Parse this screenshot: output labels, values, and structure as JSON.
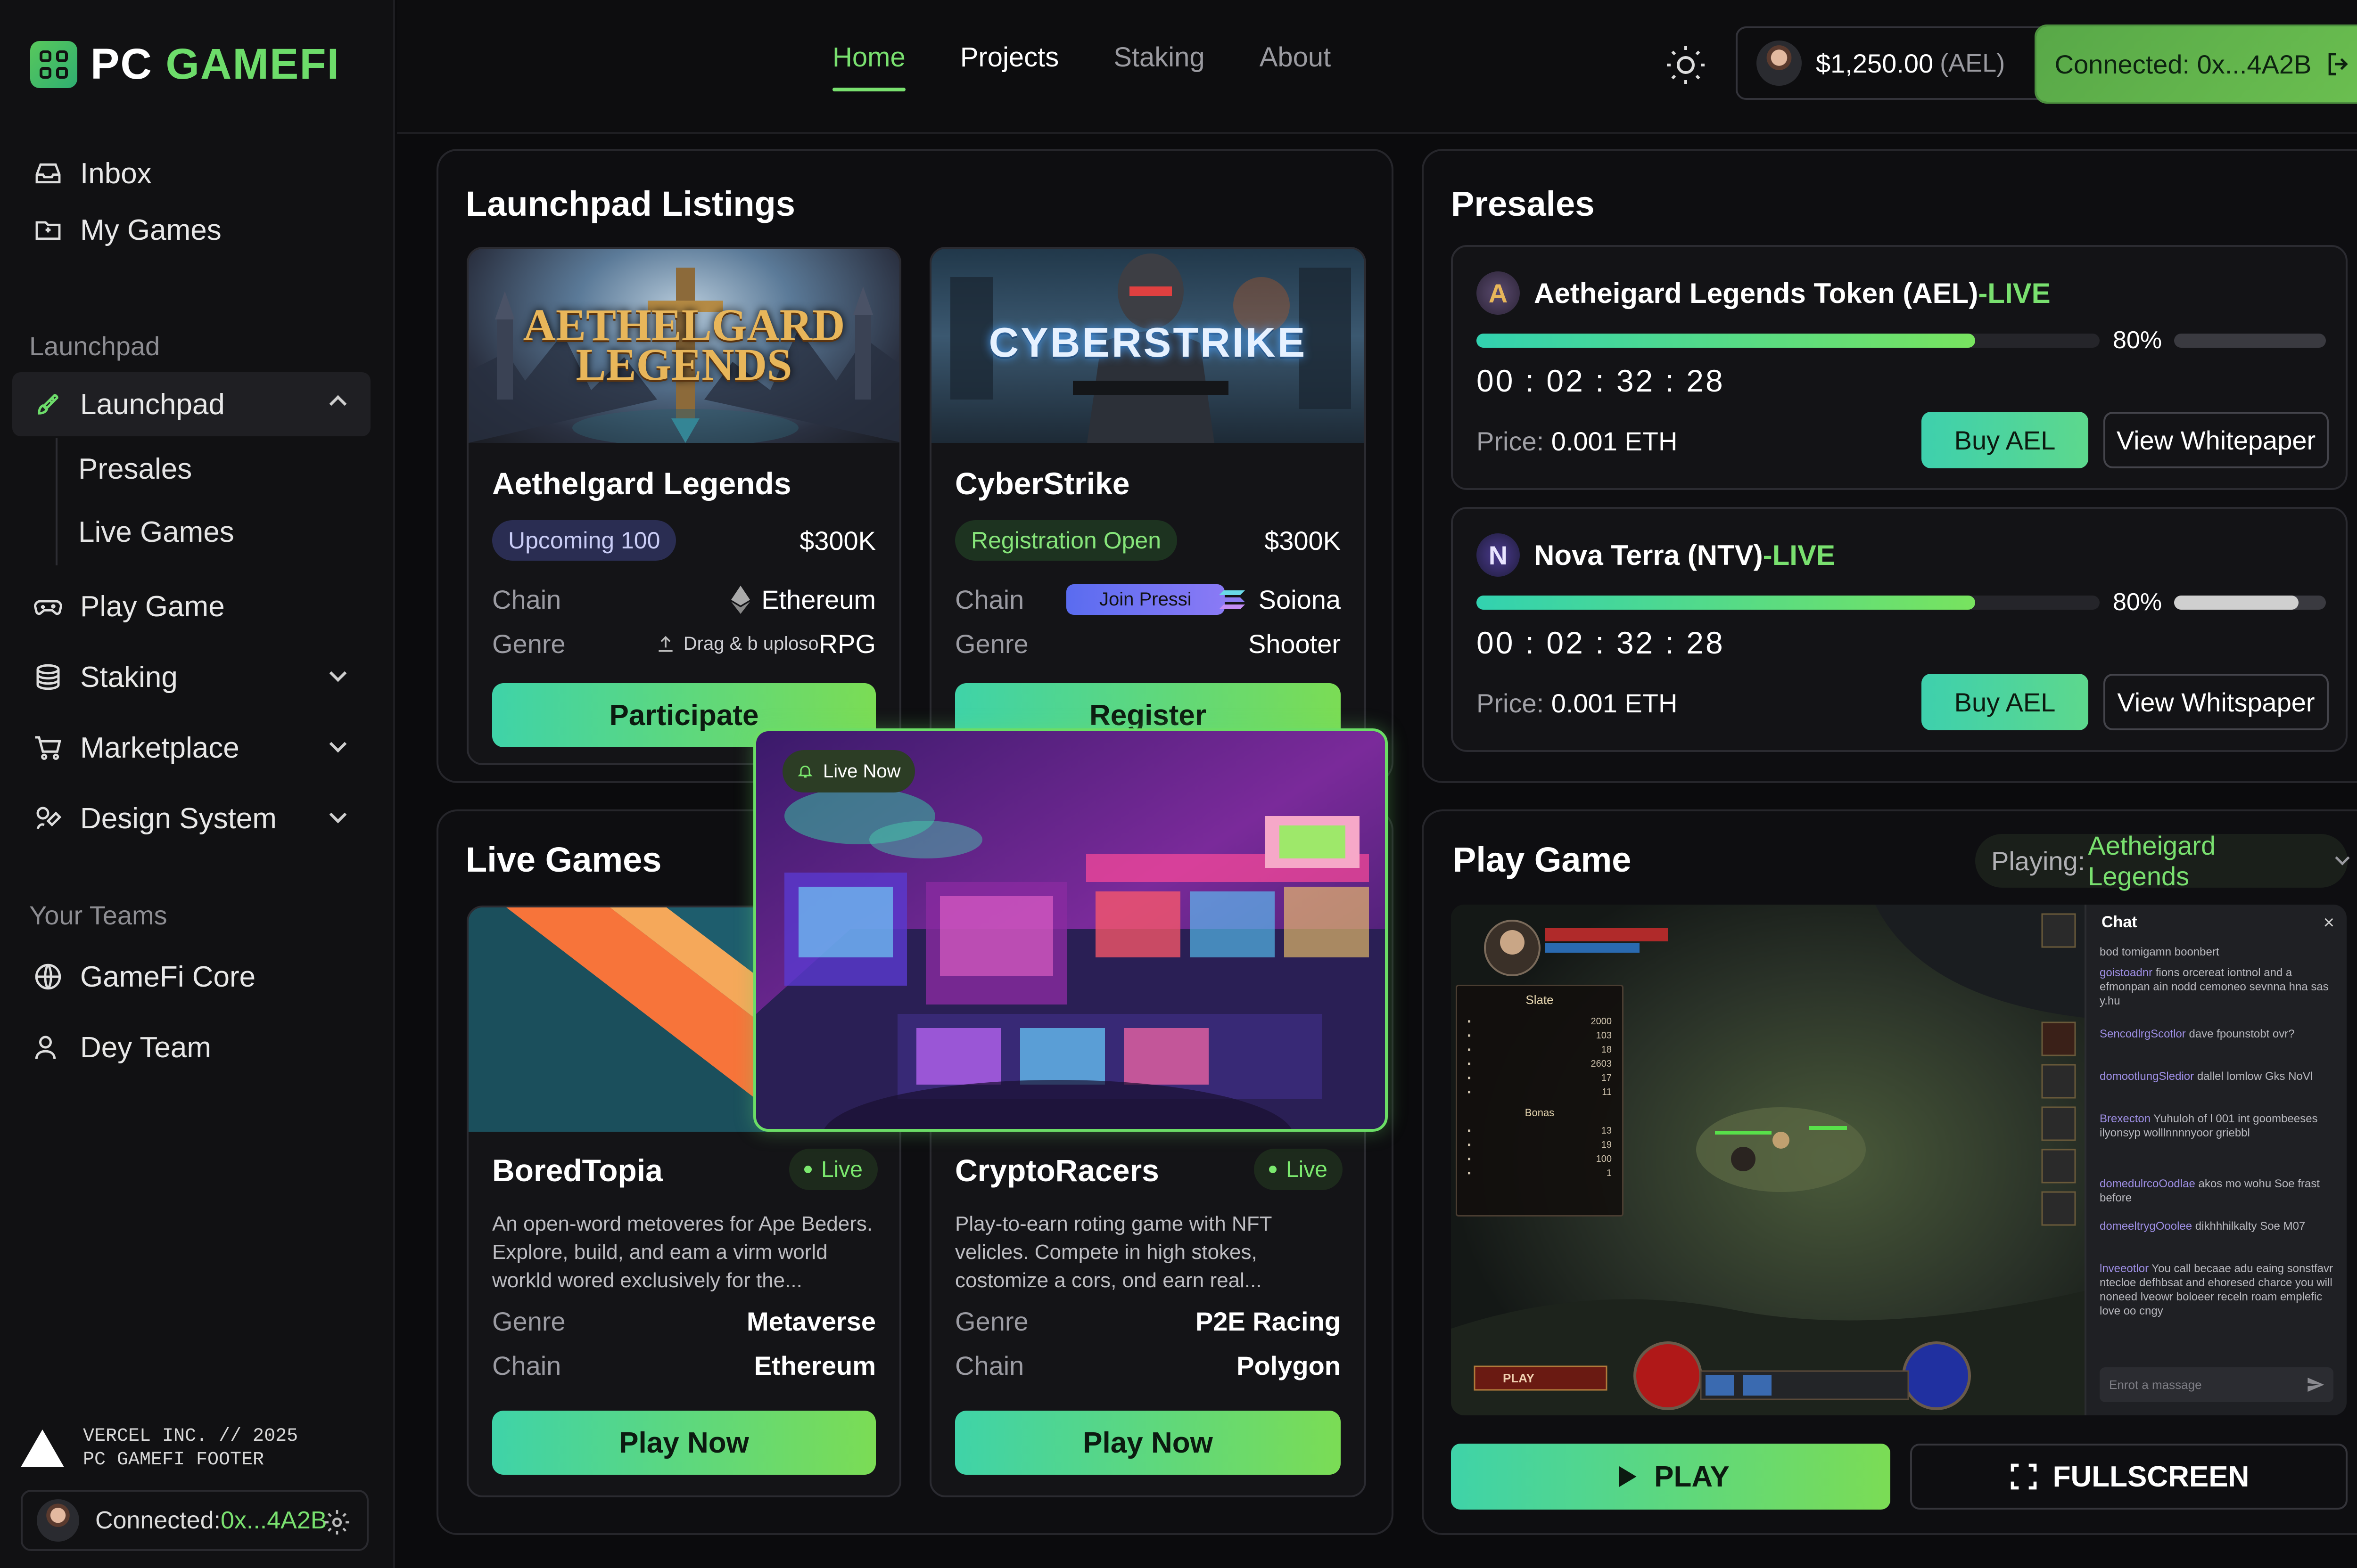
{
  "brand": {
    "name_a": "PC ",
    "name_b": "GAMEFI"
  },
  "sidebar": {
    "inbox": "Inbox",
    "my_games": "My Games",
    "section_launchpad": "Launchpad",
    "launchpad": "Launchpad",
    "presales": "Presales",
    "live_games": "Live Games",
    "play_game": "Play Game",
    "staking": "Staking",
    "marketplace": "Marketplace",
    "design_system": "Design System",
    "section_teams": "Your Teams",
    "team1": "GameFi Core",
    "team2": "Dey Team",
    "footer_line1": "VERCEL INC. // 2025",
    "footer_line2": "PC GAMEFI FOOTER",
    "connected_label": "Connected: ",
    "connected_addr": "0x...4A2B"
  },
  "topnav": {
    "tabs": [
      "Home",
      "Projects",
      "Staking",
      "About"
    ],
    "balance": "$1,250.00",
    "balance_unit": "(AEL)",
    "connect_label": "Connected: 0x...4A2B"
  },
  "launchpad": {
    "title": "Launchpad Listings",
    "cards": [
      {
        "art_title_1": "AETHELGARD",
        "art_title_2": "LEGENDS",
        "name": "Aethelgard Legends",
        "status": "Upcoming 100",
        "raise": "$300K",
        "chain_label": "Chain",
        "chain": "Ethereum",
        "genre_label": "Genre",
        "genre_hint": "Drag & b uploso",
        "genre": "RPG",
        "button": "Participate"
      },
      {
        "art_title_1": "CYBERSTRIKE",
        "name": "CyberStrike",
        "status": "Registration Open",
        "raise": "$300K",
        "chain_label": "Chain",
        "chain": "Soiona",
        "chain_tag": "Join Pressi",
        "genre_label": "Genre",
        "genre": "Shooter",
        "button": "Register"
      }
    ]
  },
  "presales": {
    "title": "Presales",
    "items": [
      {
        "logo": "A",
        "name": "Aetheigard Legends Token (AEL)",
        "sep": " - ",
        "status": "LIVE",
        "progress": 80,
        "pct": "80%",
        "countdown": "00 : 02 : 32 : 28",
        "price_label": "Price: ",
        "price": "0.001 ETH",
        "buy": "Buy AEL",
        "whitepaper": "View Whitepaper"
      },
      {
        "logo": "N",
        "name": "Nova Terra (NTV)",
        "sep": " - ",
        "status": "LIVE",
        "progress": 80,
        "pct": "80%",
        "countdown": "00 : 02 : 32 : 28",
        "price_label": "Price: ",
        "price": "0.001 ETH",
        "buy": "Buy AEL",
        "whitepaper": "View Whitspaper"
      }
    ]
  },
  "live_games": {
    "title": "Live Games",
    "live_now": "Live Now",
    "cards": [
      {
        "name": "BoredTopia",
        "badge": "Live",
        "desc": "An open-word metoveres for Ape Beders. Explore, build, and eam a virm world workld wored exclusively for the...",
        "genre_label": "Genre",
        "genre": "Metaverse",
        "chain_label": "Chain",
        "chain": "Ethereum",
        "button": "Play Now"
      },
      {
        "name": "CryptoRacers",
        "badge": "Live",
        "desc": "Play-to-earn roting game with NFT velicles. Compete in high stokes, costomize a cors, ond earn real...",
        "genre_label": "Genre",
        "genre": "P2E Racing",
        "chain_label": "Chain",
        "chain": "Polygon",
        "button": "Play Now"
      }
    ]
  },
  "play_game": {
    "title": "Play Game",
    "playing_label": "Playing: ",
    "playing_value": "Aetheigard Legends",
    "play_button": "PLAY",
    "fullscreen_button": "FULLSCREEN",
    "hud_play": "PLAY",
    "stats_title": "Slate",
    "stats_sub": "Bonas",
    "stats_values": [
      "2000",
      "103",
      "18",
      "2603",
      "17",
      "11",
      "13",
      "19",
      "100",
      "1"
    ],
    "chat": {
      "title": "Chat",
      "lines": [
        {
          "user": "",
          "text": "bod tomigamn boonbert"
        },
        {
          "user": "goistoadnr",
          "text": "fions orcereat iontnol and a efmonpan ain nodd cemoneo sevnna hna sas y.hu"
        },
        {
          "user": "SencodlrgScotlor",
          "text": "dave fpounstobt ovr?"
        },
        {
          "user": "domootlungSledior",
          "text": "dallel lomlow Gks NoVl"
        },
        {
          "user": "Brexecton",
          "text": "Yuhuloh of l 001 int goombeeses ilyonsyp wolllnnnnyoor griebbl"
        },
        {
          "user": "domedulrcoOodlae",
          "text": "akos mo wohu Soe frast before"
        },
        {
          "user": "domeeltrygOoolee",
          "text": "dikhhhilkalty Soe M07"
        },
        {
          "user": "lnveeotlor",
          "text": "You call becaae adu eaing sonstfavr ntecloe defhbsat and ehoresed charce you will noneed lveowr boloeer receln roam emplefic love oo cngy"
        }
      ],
      "input_placeholder": "Enrot a massage"
    }
  },
  "colors": {
    "accent": "#79e06f",
    "teal": "#3fd3a8",
    "bg": "#0b0b0d"
  },
  "icons": [
    "logo-icon",
    "inbox-icon",
    "folder-icon",
    "rocket-icon",
    "gamepad-icon",
    "stack-icon",
    "cart-icon",
    "palette-icon",
    "globe-icon",
    "users-icon",
    "sun-icon",
    "logout-icon",
    "settings-icon",
    "ethereum-icon",
    "upload-icon",
    "bell-icon",
    "play-icon",
    "fullscreen-icon",
    "close-icon",
    "send-icon",
    "sparkle-icon"
  ]
}
